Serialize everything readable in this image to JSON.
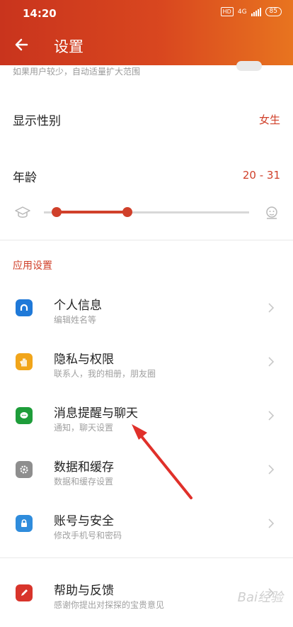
{
  "status_bar": {
    "time": "14:20",
    "hd": "HD",
    "network": "4G",
    "battery": "85"
  },
  "header": {
    "title": "设置"
  },
  "faded_setting": {
    "text": "如果用户较少，自动适量扩大范围"
  },
  "gender": {
    "label": "显示性别",
    "value": "女生"
  },
  "age": {
    "label": "年龄",
    "value": "20 - 31",
    "range_min": 20,
    "range_max": 31
  },
  "section": {
    "title": "应用设置"
  },
  "items": [
    {
      "title": "个人信息",
      "subtitle": "编辑姓名等",
      "color": "#1f79d8"
    },
    {
      "title": "隐私与权限",
      "subtitle": "联系人，我的相册，朋友圈",
      "color": "#f1a51a"
    },
    {
      "title": "消息提醒与聊天",
      "subtitle": "通知，聊天设置",
      "color": "#1e9d3a"
    },
    {
      "title": "数据和缓存",
      "subtitle": "数据和缓存设置",
      "color": "#8e8e8e"
    },
    {
      "title": "账号与安全",
      "subtitle": "修改手机号和密码",
      "color": "#2f8cdc"
    },
    {
      "title": "帮助与反馈",
      "subtitle": "感谢你提出对探探的宝贵意见",
      "color": "#d8342b"
    }
  ],
  "colors": {
    "accent": "#d0402a",
    "header_start": "#c9341d",
    "header_end": "#e8741f"
  }
}
